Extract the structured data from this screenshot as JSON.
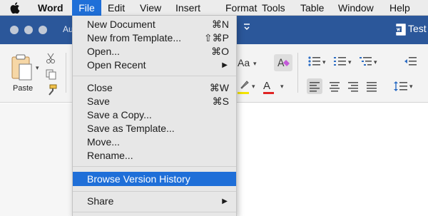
{
  "menubar": {
    "app": "Word",
    "items": [
      "File",
      "Edit",
      "View",
      "Insert",
      "Format",
      "Tools",
      "Table",
      "Window",
      "Help"
    ],
    "active_item": "File"
  },
  "titlebar": {
    "autosave_label": "Au",
    "doc_title": "Test"
  },
  "ribbon": {
    "paste_label": "Paste",
    "change_case_label": "Aa"
  },
  "file_menu": {
    "items": [
      {
        "label": "New Document",
        "shortcut": "⌘N"
      },
      {
        "label": "New from Template...",
        "shortcut": "⇧⌘P"
      },
      {
        "label": "Open...",
        "shortcut": "⌘O"
      },
      {
        "label": "Open Recent",
        "submenu_arrow": "▶"
      },
      {
        "label": "Close",
        "shortcut": "⌘W"
      },
      {
        "label": "Save",
        "shortcut": "⌘S"
      },
      {
        "label": "Save a Copy..."
      },
      {
        "label": "Save as Template..."
      },
      {
        "label": "Move..."
      },
      {
        "label": "Rename..."
      },
      {
        "label": "Browse Version History",
        "selected": true
      },
      {
        "label": "Share",
        "submenu_arrow": "▶"
      }
    ]
  },
  "colors": {
    "menu_highlight": "#1f6fd8",
    "titlebar": "#2b579a",
    "menu_background": "#e7e7e7",
    "font_color_accent": "#e02424",
    "highlight_accent": "#f4e400"
  }
}
